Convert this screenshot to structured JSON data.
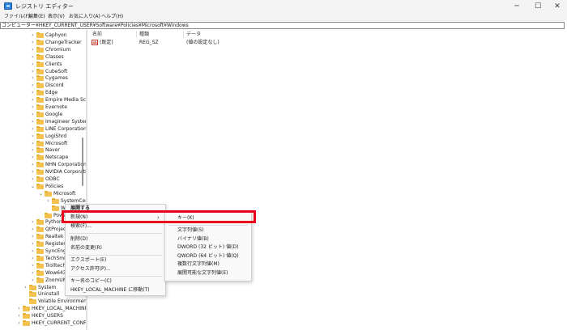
{
  "window": {
    "title": "レジストリ エディター",
    "minimize": "─",
    "maximize": "☐",
    "close": "✕"
  },
  "menubar": [
    "ファイル(F)",
    "編集(E)",
    "表示(V)",
    "お気に入り(A)",
    "ヘルプ(H)"
  ],
  "address": "コンピューター¥HKEY_CURRENT_USER¥Software¥Policies¥Microsoft¥Windows",
  "tree": [
    {
      "label": "Caphyon",
      "depth": 2,
      "chev": "›"
    },
    {
      "label": "ChangeTracker",
      "depth": 2,
      "chev": "›"
    },
    {
      "label": "Chromium",
      "depth": 2,
      "chev": "›"
    },
    {
      "label": "Classes",
      "depth": 2,
      "chev": "›"
    },
    {
      "label": "Clients",
      "depth": 2,
      "chev": "›"
    },
    {
      "label": "CubeSoft",
      "depth": 2,
      "chev": "›"
    },
    {
      "label": "Cygames",
      "depth": 2,
      "chev": "›"
    },
    {
      "label": "Discord",
      "depth": 2,
      "chev": "›"
    },
    {
      "label": "Edge",
      "depth": 2,
      "chev": "›"
    },
    {
      "label": "Empire Media Science",
      "depth": 2,
      "chev": "›"
    },
    {
      "label": "Evernote",
      "depth": 2,
      "chev": "›"
    },
    {
      "label": "Google",
      "depth": 2,
      "chev": "›"
    },
    {
      "label": "Imagineer Systems L",
      "depth": 2,
      "chev": "›"
    },
    {
      "label": "LINE Corporation",
      "depth": 2,
      "chev": "›"
    },
    {
      "label": "LogiShrd",
      "depth": 2,
      "chev": "›"
    },
    {
      "label": "Microsoft",
      "depth": 2,
      "chev": "›"
    },
    {
      "label": "Naver",
      "depth": 2,
      "chev": "›"
    },
    {
      "label": "Netscape",
      "depth": 2,
      "chev": "›"
    },
    {
      "label": "NHN Corporation",
      "depth": 2,
      "chev": "›"
    },
    {
      "label": "NVIDIA Corporation",
      "depth": 2,
      "chev": "›"
    },
    {
      "label": "ODBC",
      "depth": 2,
      "chev": "›"
    },
    {
      "label": "Policies",
      "depth": 2,
      "chev": "⌄"
    },
    {
      "label": "Microsoft",
      "depth": 3,
      "chev": "⌄"
    },
    {
      "label": "SystemCertific",
      "depth": 4,
      "chev": "›"
    },
    {
      "label": "Windows",
      "depth": 4,
      "chev": ""
    },
    {
      "label": "Powe",
      "depth": 3,
      "chev": ""
    },
    {
      "label": "Python",
      "depth": 2,
      "chev": "›"
    },
    {
      "label": "QtProject",
      "depth": 2,
      "chev": "›"
    },
    {
      "label": "Realtek",
      "depth": 2,
      "chev": "›"
    },
    {
      "label": "Registere",
      "depth": 2,
      "chev": "›"
    },
    {
      "label": "SyncEng",
      "depth": 2,
      "chev": "›"
    },
    {
      "label": "TechSmit",
      "depth": 2,
      "chev": "›"
    },
    {
      "label": "Trolltech",
      "depth": 2,
      "chev": "›"
    },
    {
      "label": "Wow643",
      "depth": 2,
      "chev": "›"
    },
    {
      "label": "ZoomUM",
      "depth": 2,
      "chev": "›"
    },
    {
      "label": "System",
      "depth": 1,
      "chev": "›"
    },
    {
      "label": "Uninstall",
      "depth": 1,
      "chev": ""
    },
    {
      "label": "Volatile Environment",
      "depth": 1,
      "chev": ""
    },
    {
      "label": "HKEY_LOCAL_MACHINE",
      "depth": 0,
      "chev": "›"
    },
    {
      "label": "HKEY_USERS",
      "depth": 0,
      "chev": "›"
    },
    {
      "label": "HKEY_CURRENT_CONFIG",
      "depth": 0,
      "chev": "›"
    }
  ],
  "columns": {
    "name": "名前",
    "type": "種類",
    "data": "データ"
  },
  "values": [
    {
      "name": "(既定)",
      "type": "REG_SZ",
      "data": "(値の設定なし)"
    }
  ],
  "context_menu": {
    "items": [
      "展開する",
      "新規(N)",
      "検索(F)...",
      "削除(D)",
      "名前の変更(R)",
      "エクスポート(E)",
      "アクセス許可(P)...",
      "キー名のコピー(C)",
      "HKEY_LOCAL_MACHINE に移動(T)"
    ],
    "submenu_arrow": "›"
  },
  "submenu": {
    "items": [
      "キー(K)",
      "文字列値(S)",
      "バイナリ値(B)",
      "DWORD (32 ビット) 値(D)",
      "QWORD (64 ビット) 値(Q)",
      "複数行文字列値(M)",
      "展開可能な文字列値(E)"
    ]
  },
  "colors": {
    "highlight": "#e8001c",
    "folder": "#f2c14e",
    "accent": "#2b7fd6"
  }
}
